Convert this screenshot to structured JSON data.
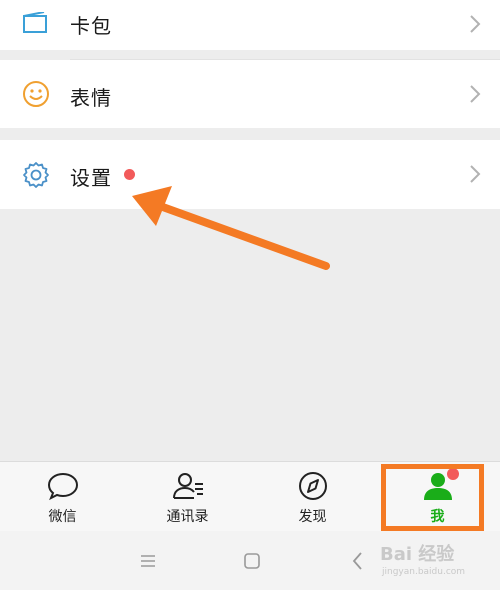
{
  "menu": {
    "items": [
      {
        "label": "卡包",
        "icon": "card-wallet-icon"
      },
      {
        "label": "表情",
        "icon": "smiley-icon"
      },
      {
        "label": "设置",
        "icon": "gear-icon",
        "has_badge": true
      }
    ]
  },
  "tabbar": {
    "tabs": [
      {
        "label": "微信",
        "icon": "chat-bubble-icon",
        "active": false
      },
      {
        "label": "通讯录",
        "icon": "contacts-icon",
        "active": false
      },
      {
        "label": "发现",
        "icon": "compass-icon",
        "active": false
      },
      {
        "label": "我",
        "icon": "person-icon",
        "active": true,
        "has_badge": true
      }
    ]
  },
  "system_nav": {
    "buttons": [
      "menu-icon",
      "home-square-icon",
      "back-chevron-icon"
    ]
  },
  "watermark": {
    "main": "Bai 经验",
    "sub": "jingyan.baidu.com"
  },
  "colors": {
    "accent_green": "#1aad19",
    "badge_red": "#f25a5a",
    "annotation_orange": "#f47a24",
    "icon_blue": "#4a90c8",
    "icon_orange": "#f0a030"
  }
}
